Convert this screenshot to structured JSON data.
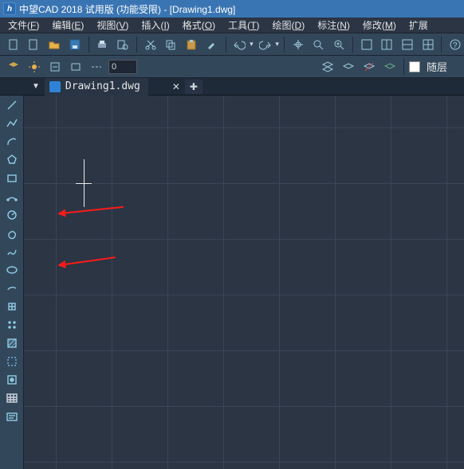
{
  "titlebar": {
    "app_logo_letter": "h",
    "title": "中望CAD 2018 试用版 (功能受限) - [Drawing1.dwg]"
  },
  "menubar": [
    {
      "label": "文件",
      "hk": "F"
    },
    {
      "label": "编辑",
      "hk": "E"
    },
    {
      "label": "视图",
      "hk": "V"
    },
    {
      "label": "插入",
      "hk": "I"
    },
    {
      "label": "格式",
      "hk": "O"
    },
    {
      "label": "工具",
      "hk": "T"
    },
    {
      "label": "绘图",
      "hk": "D"
    },
    {
      "label": "标注",
      "hk": "N"
    },
    {
      "label": "修改",
      "hk": "M"
    },
    {
      "label": "扩展",
      "hk": ""
    }
  ],
  "toolbar1": {
    "linewidth_value": "0"
  },
  "layer": {
    "label": "随层"
  },
  "tab": {
    "filename": "Drawing1.dwg"
  }
}
